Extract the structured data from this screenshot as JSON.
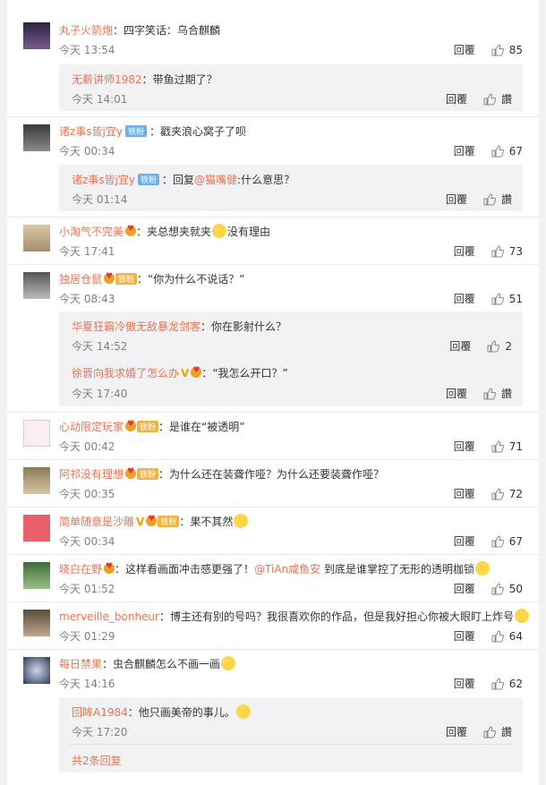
{
  "icons": {
    "like": "thumbs-up-icon"
  },
  "comments": [
    {
      "user": "丸子火箭炮",
      "sep": "：",
      "text": "四字笑话：乌合麒麟",
      "time": "今天 13:54",
      "reply": "回覆",
      "likes": "85",
      "replies": [
        {
          "user": "无薪讲师1982",
          "sep": "：",
          "text": "带鱼过期了？",
          "time": "今天 14:01",
          "reply": "回覆",
          "likes": "讚"
        }
      ]
    },
    {
      "user": "诸z事s皆j宜y",
      "badge": "铁粉",
      "sep": "：",
      "text": "戳夹浪心窝子了呗",
      "time": "今天 00:34",
      "reply": "回覆",
      "likes": "67",
      "replies": [
        {
          "user": "诸z事s皆j宜y",
          "badge": "铁粉",
          "sep": "：回复",
          "mention": "@猫嘴健",
          "text": ":什么意思？",
          "time": "今天 01:14",
          "reply": "回覆",
          "likes": "讚"
        }
      ]
    },
    {
      "user": "小淘气不完美",
      "sep": "：",
      "text": "夹总想夹就夹",
      "text2": "没有理由",
      "time": "今天 17:41",
      "reply": "回覆",
      "likes": "73"
    },
    {
      "user": "独居仓鼠",
      "fan": "铁粉",
      "sep": "：",
      "text": "“你为什么不说话？”",
      "time": "今天 08:43",
      "reply": "回覆",
      "likes": "51",
      "replies": [
        {
          "user": "华夏狂霸冷傲无敌暴龙剑客",
          "sep": "：",
          "text": "你在影射什么？",
          "time": "今天 14:52",
          "reply": "回覆",
          "likes": "2"
        },
        {
          "user": "徐晋向我求婚了怎么办",
          "sep": "：",
          "text": "“我怎么开口？”",
          "time": "今天 17:40",
          "reply": "回覆",
          "likes": "讚"
        }
      ]
    },
    {
      "user": "心动限定玩家",
      "fan": "铁粉",
      "sep": "：",
      "text": "是谁在“被透明”",
      "time": "今天 00:42",
      "reply": "回覆",
      "likes": "71"
    },
    {
      "user": "阿祁没有理想",
      "fan": "铁粉",
      "sep": "：",
      "text": "为什么还在装聋作哑？为什么还要装聋作哑？",
      "time": "今天 00:35",
      "reply": "回覆",
      "likes": "72"
    },
    {
      "user": "简单随意是沙雕",
      "fan": "铁粉",
      "sep": "：",
      "text": "果不其然",
      "time": "今天 00:34",
      "reply": "回覆",
      "likes": "67"
    },
    {
      "user": "晓白在野",
      "sep": "：",
      "text": "这样看画面冲击感更强了！",
      "mention": "@TiAn咸鱼安",
      "text2": " 到底是谁掌控了无形的透明枷锁",
      "time": "今天 01:52",
      "reply": "回覆",
      "likes": "50"
    },
    {
      "user": "merveille_bonheur",
      "sep": "：",
      "text": "博主还有别的号吗？我很喜欢你的作品，但是我好担心你被大眼盯上炸号",
      "time": "今天 01:29",
      "reply": "回覆",
      "likes": "64"
    },
    {
      "user": "每日禁果",
      "sep": "：",
      "text": "虫合麒麟怎么不画一画",
      "time": "今天 14:16",
      "reply": "回覆",
      "likes": "62",
      "replies": [
        {
          "user": "回眸A1984",
          "sep": "：",
          "text": "他只画美帝的事儿。",
          "time": "今天 17:20",
          "reply": "回覆",
          "likes": "讚"
        }
      ],
      "more": "共2条回复"
    }
  ]
}
